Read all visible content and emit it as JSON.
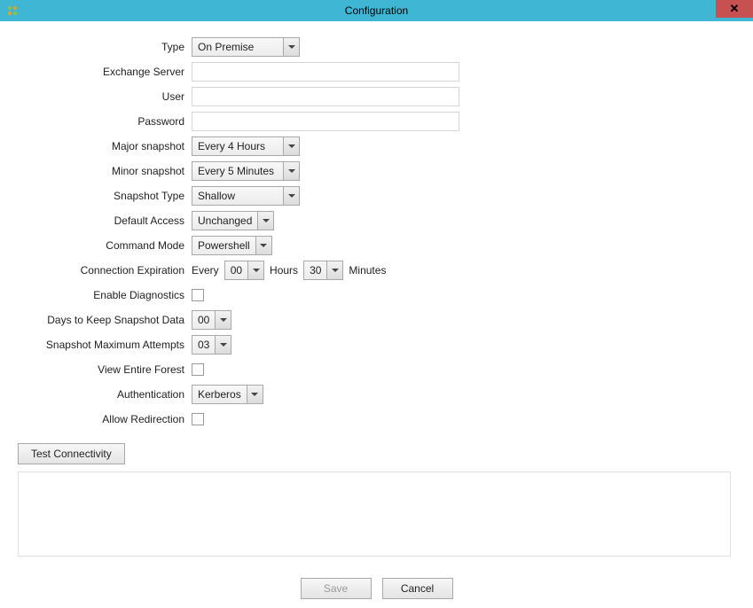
{
  "window": {
    "title": "Configuration"
  },
  "labels": {
    "type": "Type",
    "exchangeServer": "Exchange Server",
    "user": "User",
    "password": "Password",
    "majorSnapshot": "Major snapshot",
    "minorSnapshot": "Minor snapshot",
    "snapshotType": "Snapshot Type",
    "defaultAccess": "Default Access",
    "commandMode": "Command Mode",
    "connectionExpiration": "Connection Expiration",
    "enableDiagnostics": "Enable Diagnostics",
    "daysToKeep": "Days to Keep Snapshot Data",
    "maxAttempts": "Snapshot Maximum Attempts",
    "viewForest": "View Entire Forest",
    "authentication": "Authentication",
    "allowRedirection": "Allow Redirection"
  },
  "values": {
    "type": "On Premise",
    "exchangeServer": "",
    "user": "",
    "password": "",
    "majorSnapshot": "Every 4 Hours",
    "minorSnapshot": "Every 5 Minutes",
    "snapshotType": "Shallow",
    "defaultAccess": "Unchanged",
    "commandMode": "Powershell",
    "expiration": {
      "everyLabel": "Every",
      "hours": "00",
      "hoursLabel": "Hours",
      "minutes": "30",
      "minutesLabel": "Minutes"
    },
    "daysToKeep": "00",
    "maxAttempts": "03",
    "authentication": "Kerberos"
  },
  "buttons": {
    "testConnectivity": "Test Connectivity",
    "save": "Save",
    "cancel": "Cancel"
  }
}
